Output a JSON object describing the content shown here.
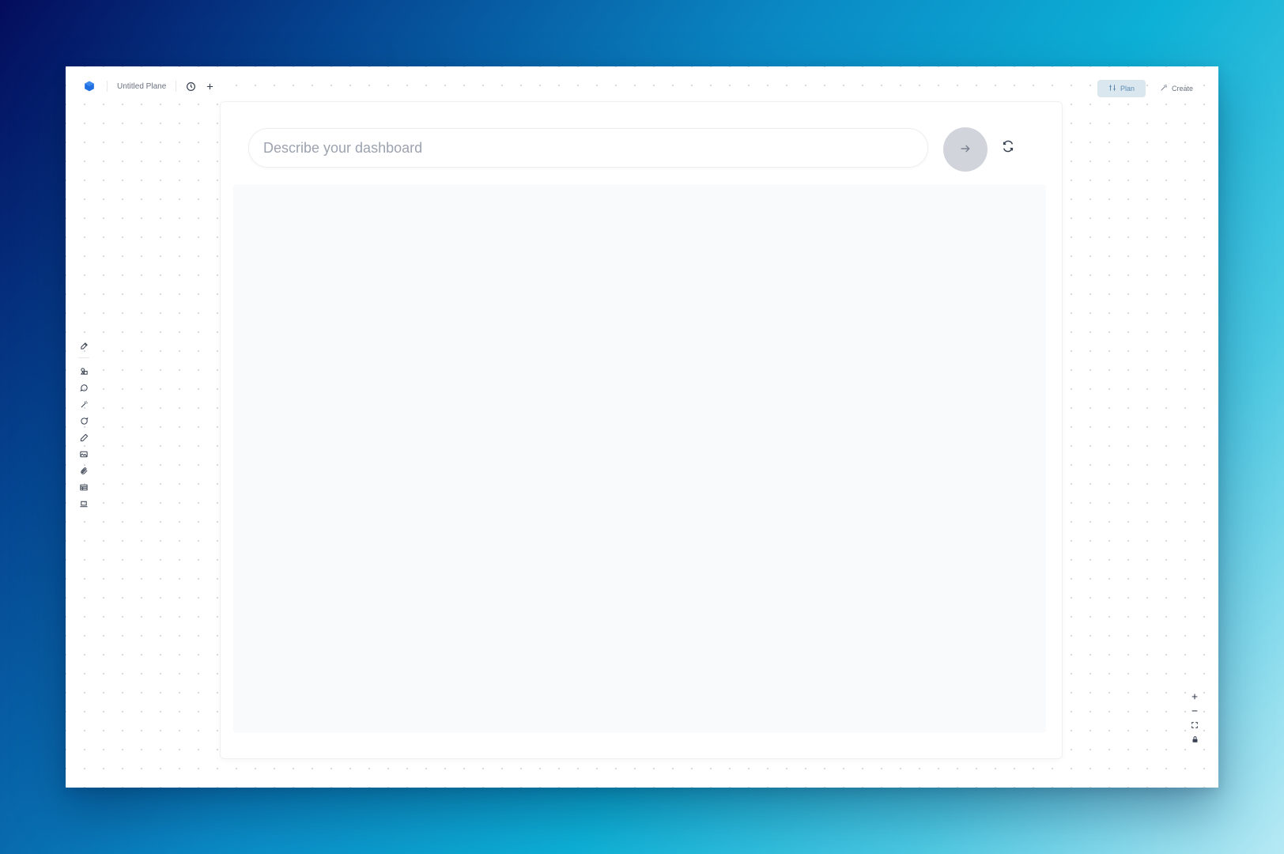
{
  "window": {
    "doc_title": "Untitled Plane"
  },
  "header": {
    "history_icon": "clock-icon",
    "add_icon": "plus-icon",
    "logo_icon": "hexagon-logo-icon"
  },
  "modes": [
    {
      "label": "Plan",
      "icon": "plan-icon",
      "active": true
    },
    {
      "label": "Create",
      "icon": "magic-wand-icon",
      "active": false
    }
  ],
  "tools": [
    "pencil-icon",
    "shapes-icon",
    "chat-bubble-icon",
    "wand-icon",
    "comment-icon",
    "pen-icon",
    "image-icon",
    "paperclip-icon",
    "table-icon",
    "laptop-icon"
  ],
  "prompt": {
    "placeholder": "Describe your dashboard",
    "value": ""
  },
  "zoom": [
    "zoom-in-icon",
    "zoom-out-icon",
    "fit-screen-icon",
    "lock-icon"
  ],
  "colors": {
    "logo": "#1f6fe0",
    "active_mode_bg": "#dbe7ef",
    "active_mode_text": "#5b8bb3",
    "submit_bg": "#d1d5db"
  }
}
